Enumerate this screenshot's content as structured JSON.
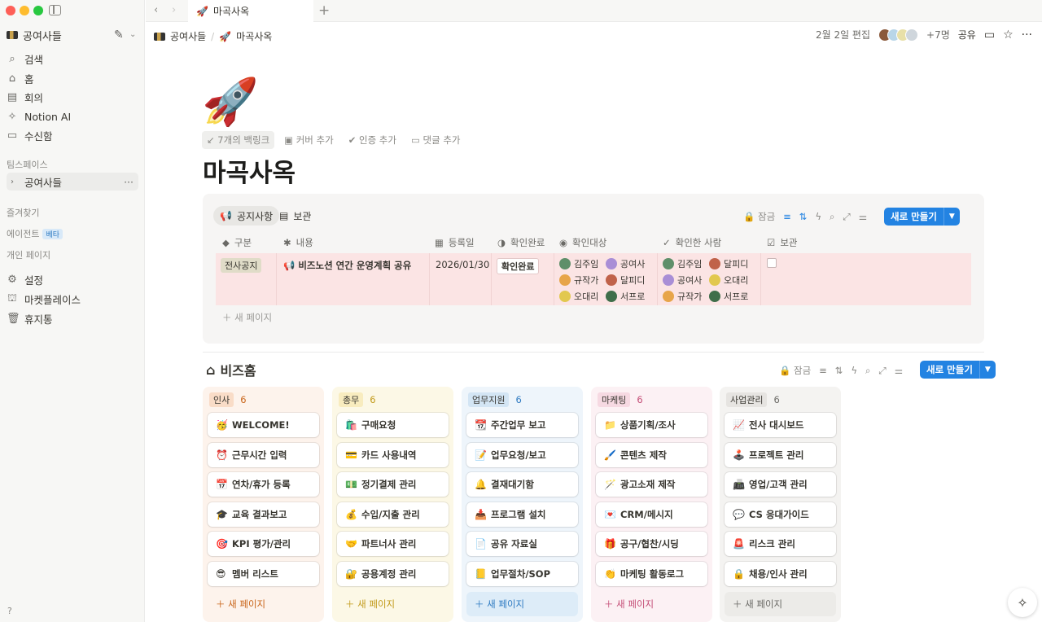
{
  "window": {
    "tab_title": "마곡사옥",
    "tab_icon": "rocket-icon"
  },
  "sidebar": {
    "workspace": "공여사들",
    "nav": [
      {
        "label": "검색",
        "icon": "search-icon"
      },
      {
        "label": "홈",
        "icon": "home-icon"
      },
      {
        "label": "회의",
        "icon": "meeting-icon"
      },
      {
        "label": "Notion AI",
        "icon": "notion-ai-icon"
      },
      {
        "label": "수신함",
        "icon": "inbox-icon"
      }
    ],
    "teamspace_label": "팀스페이스",
    "teamspace_item": "공여사들",
    "favorites_label": "즐겨찾기",
    "agent_label": "에이전트",
    "agent_badge": "베타",
    "private_label": "개인 페이지",
    "bottom": [
      {
        "label": "설정",
        "icon": "settings-icon"
      },
      {
        "label": "마켓플레이스",
        "icon": "marketplace-icon"
      },
      {
        "label": "휴지통",
        "icon": "trash-icon"
      }
    ]
  },
  "header": {
    "breadcrumb_workspace": "공여사들",
    "breadcrumb_page": "마곡사옥",
    "edited": "2월 2일 편집",
    "more_people": "+7명",
    "share": "공유"
  },
  "page": {
    "title": "마곡사옥",
    "backlinks": "7개의 백링크",
    "add_cover": "커버 추가",
    "add_verification": "인증 추가",
    "add_comment": "댓글 추가"
  },
  "notice_db": {
    "views": [
      "공지사항",
      "보관"
    ],
    "lock": "잠금",
    "new_button": "새로 만들기",
    "columns": [
      "구분",
      "내용",
      "등록일",
      "확인완료",
      "확인대상",
      "확인한 사람",
      "보관"
    ],
    "row": {
      "category": "전사공지",
      "content": "비즈노션 연간 운영계획 공유",
      "date": "2026/01/30",
      "status": "확인완료",
      "targets": [
        "김주임",
        "공여사",
        "규작가",
        "달피디",
        "오대리",
        "서프로"
      ],
      "confirmed": [
        "김주임",
        "달피디",
        "공여사",
        "오대리",
        "규작가",
        "서프로"
      ]
    },
    "new_page": "새 페이지"
  },
  "board": {
    "title": "비즈홈",
    "lock": "잠금",
    "new_button": "새로 만들기",
    "new_page": "새 페이지",
    "groups": [
      {
        "name": "인사",
        "count": "6",
        "bg": "#fdf3ec",
        "tag": "#f9dcc7",
        "text": "#c9651a",
        "items": [
          [
            "🥳",
            "WELCOME!"
          ],
          [
            "⏰",
            "근무시간 입력"
          ],
          [
            "📅",
            "연차/휴가 등록"
          ],
          [
            "🎓",
            "교육 결과보고"
          ],
          [
            "🎯",
            "KPI 평가/관리"
          ],
          [
            "😎",
            "멤버 리스트"
          ]
        ]
      },
      {
        "name": "총무",
        "count": "6",
        "bg": "#fcf8e6",
        "tag": "#f8ecbf",
        "text": "#c29a1a",
        "items": [
          [
            "🛍️",
            "구매요청"
          ],
          [
            "💳",
            "카드 사용내역"
          ],
          [
            "💵",
            "정기결제 관리"
          ],
          [
            "💰",
            "수입/지출 관리"
          ],
          [
            "🤝",
            "파트너사 관리"
          ],
          [
            "🔐",
            "공용계정 관리"
          ]
        ]
      },
      {
        "name": "업무지원",
        "count": "6",
        "bg": "#eef5fb",
        "tag": "#d3e5f4",
        "text": "#2f7bc2",
        "items": [
          [
            "📆",
            "주간업무 보고"
          ],
          [
            "📝",
            "업무요청/보고"
          ],
          [
            "🔔",
            "결재대기함"
          ],
          [
            "📥",
            "프로그램 설치"
          ],
          [
            "📄",
            "공유 자료실"
          ],
          [
            "📒",
            "업무절차/SOP"
          ]
        ]
      },
      {
        "name": "마케팅",
        "count": "6",
        "bg": "#fcf1f4",
        "tag": "#f6d9e2",
        "text": "#c44d76",
        "items": [
          [
            "📁",
            "상품기획/조사"
          ],
          [
            "🖌️",
            "콘텐츠 제작"
          ],
          [
            "🪄",
            "광고소재 제작"
          ],
          [
            "💌",
            "CRM/메시지"
          ],
          [
            "🎁",
            "공구/협찬/시딩"
          ],
          [
            "👏",
            "마케팅 활동로그"
          ]
        ]
      },
      {
        "name": "사업관리",
        "count": "6",
        "bg": "#f4f3f1",
        "tag": "#e6e4e1",
        "text": "#6b6a66",
        "items": [
          [
            "📈",
            "전사 대시보드"
          ],
          [
            "🕹️",
            "프로젝트 관리"
          ],
          [
            "📠",
            "영업/고객 관리"
          ],
          [
            "💬",
            "CS 응대가이드"
          ],
          [
            "🚨",
            "리스크 관리"
          ],
          [
            "🔒",
            "채용/인사 관리"
          ]
        ]
      }
    ]
  }
}
